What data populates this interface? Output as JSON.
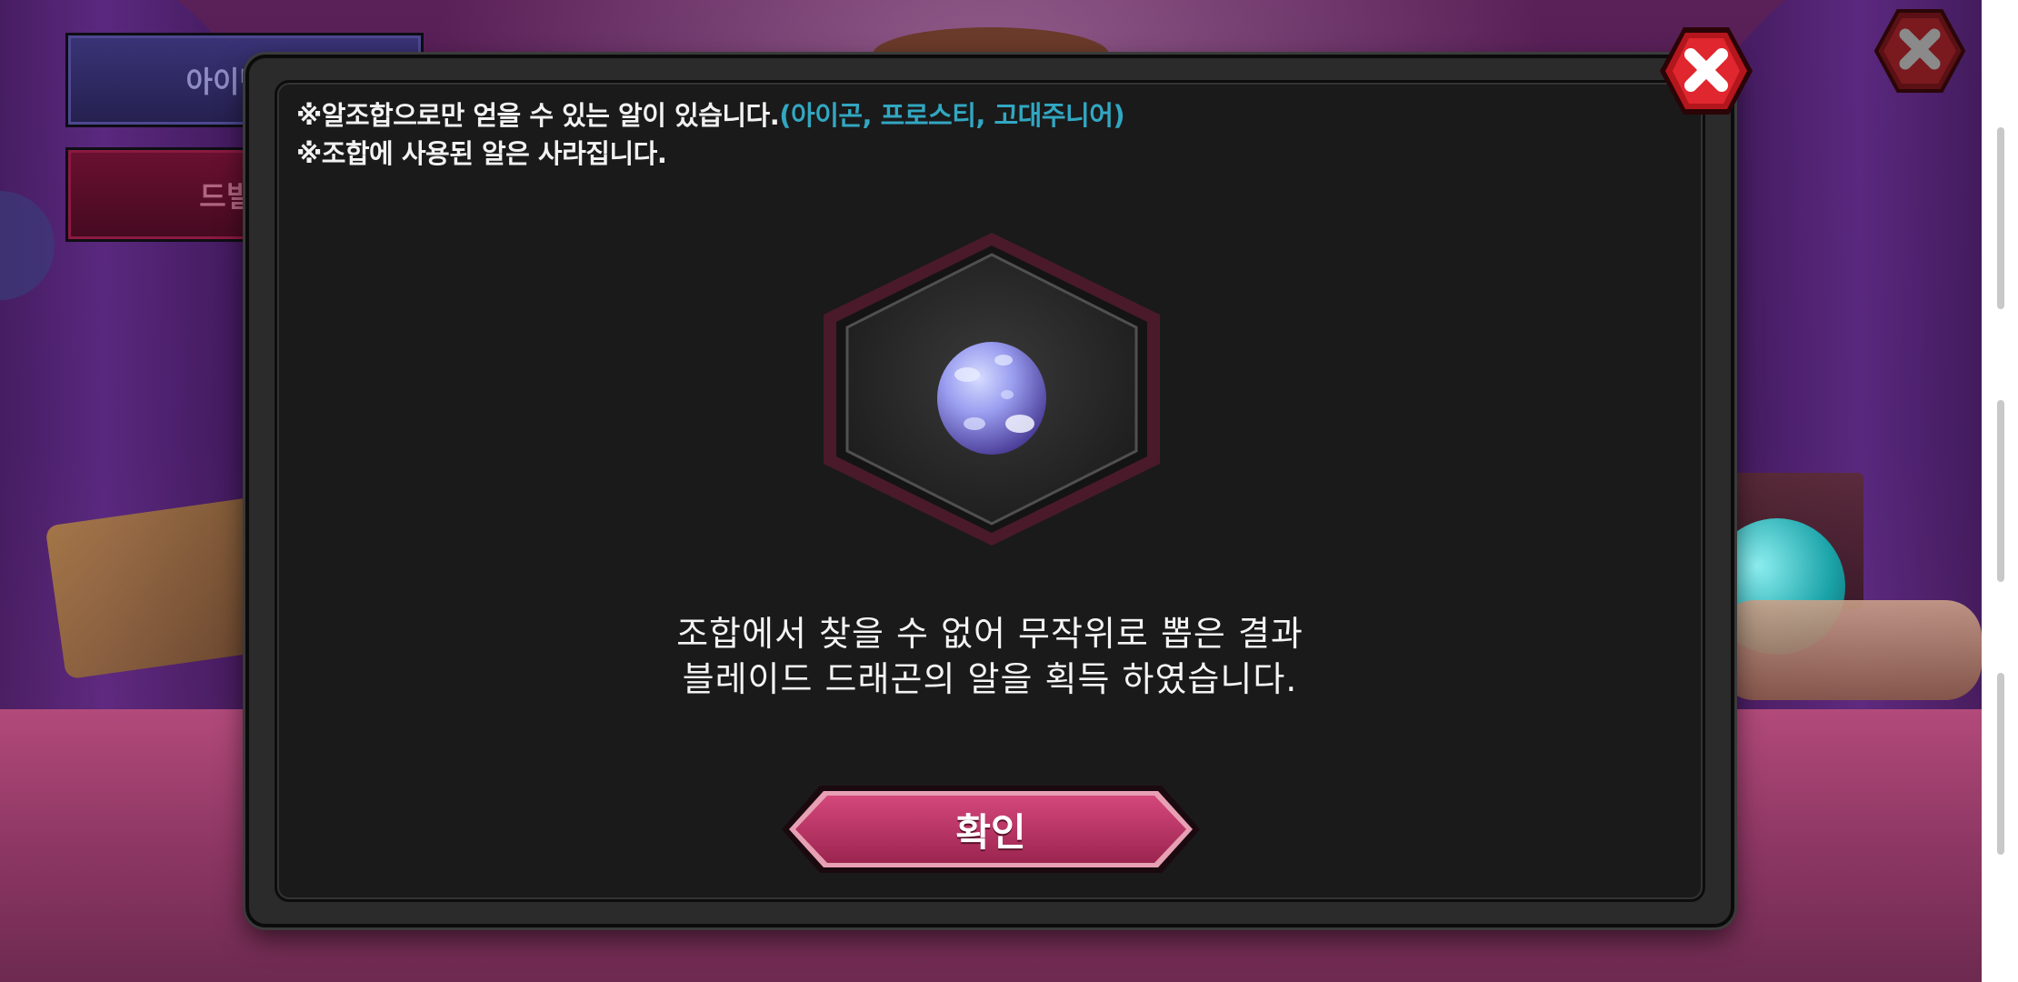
{
  "background": {
    "item_code_button": "아이템 코",
    "dbil_button": "드빌 가"
  },
  "dialog": {
    "notice_line1_prefix": "※알조합으로만 얻을 수 있는 알이 있습니다.",
    "notice_line1_highlight": "(아이곤, 프로스티, 고대주니어)",
    "notice_line2": "※조합에 사용된 알은 사라집니다.",
    "result_line1": "조합에서 찾을 수 없어 무작위로 뽑은 결과",
    "result_line2": "블레이드 드래곤의 알을 획득 하였습니다.",
    "confirm_label": "확인",
    "reward_icon": "egg-icon"
  },
  "colors": {
    "highlight": "#32a7c2",
    "confirm_button": "#b9335f",
    "close_button": "#d8262c",
    "hex_border": "#4a1a2a"
  }
}
